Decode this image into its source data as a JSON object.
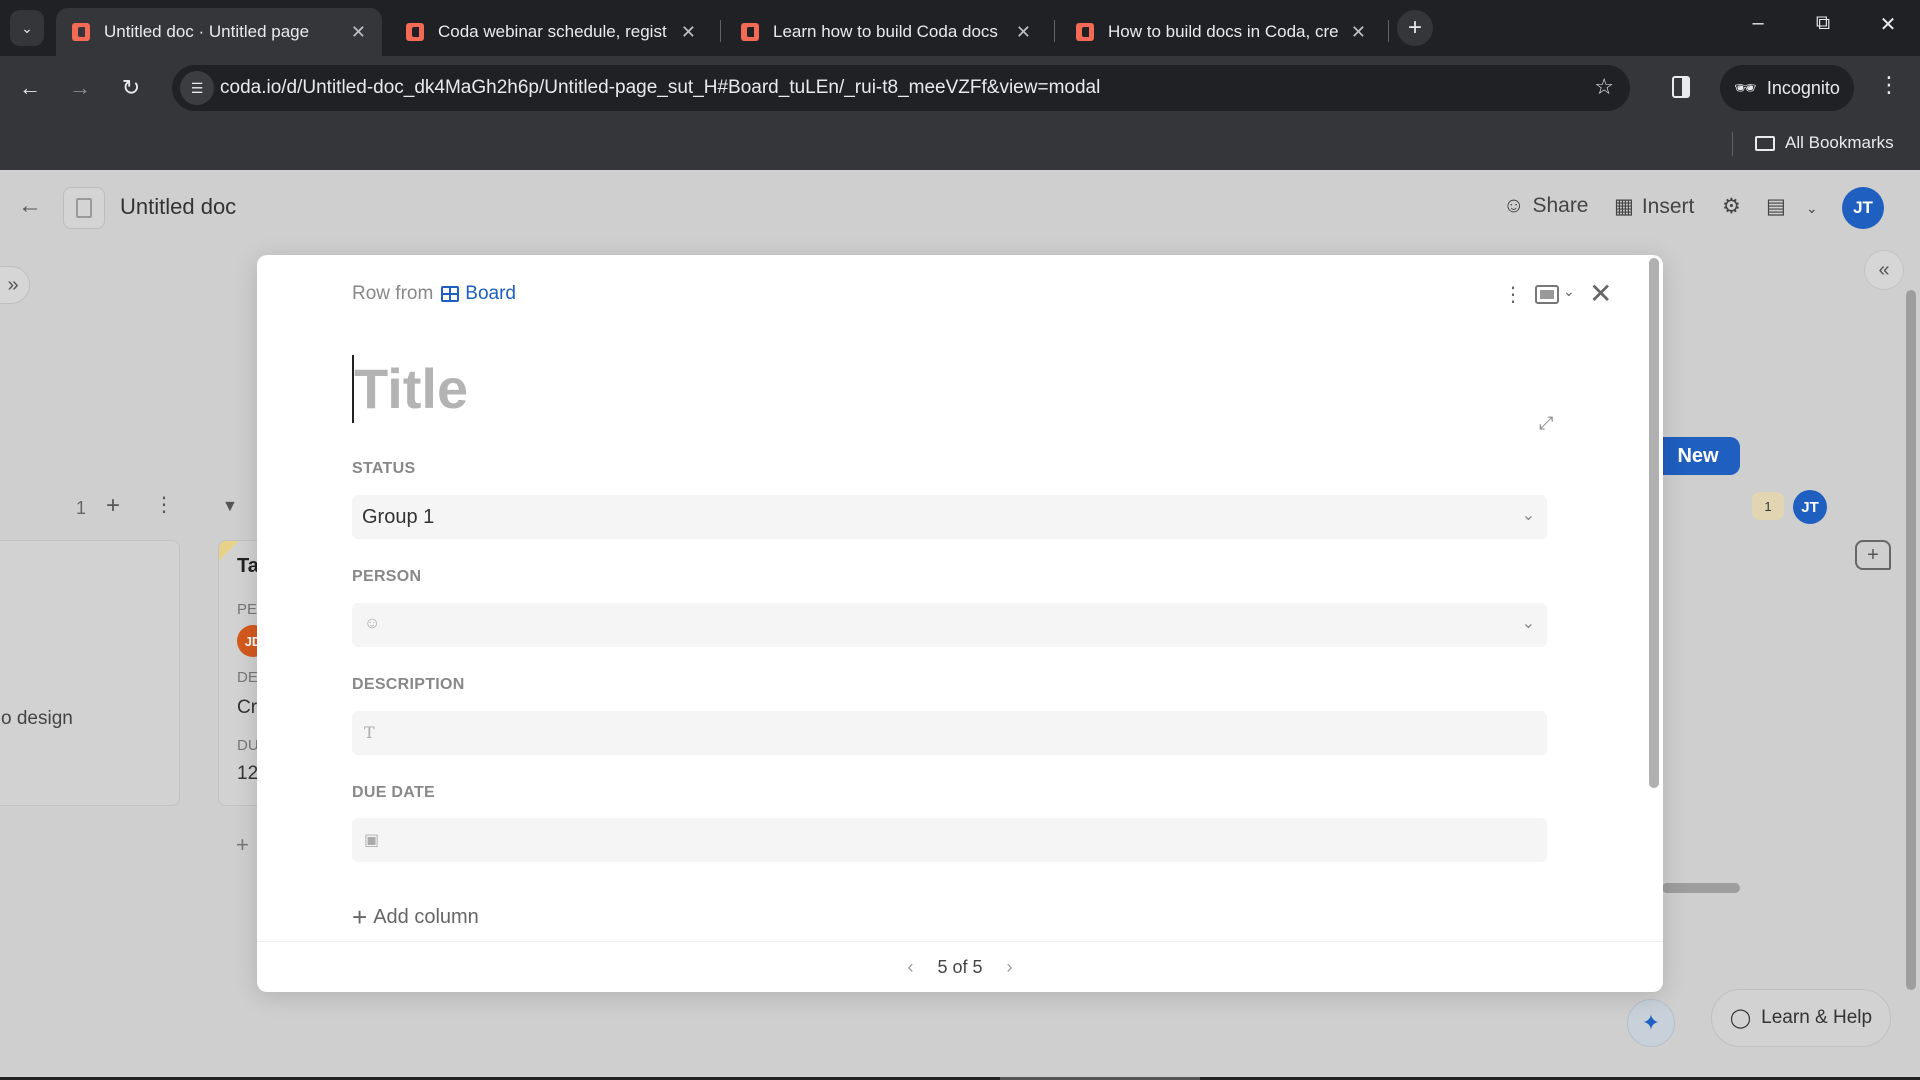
{
  "browser": {
    "tabs": [
      {
        "title": "Untitled doc · Untitled page",
        "active": true
      },
      {
        "title": "Coda webinar schedule, regist",
        "active": false
      },
      {
        "title": "Learn how to build Coda docs",
        "active": false
      },
      {
        "title": "How to build docs in Coda, cre",
        "active": false
      }
    ],
    "url": "coda.io/d/Untitled-doc_dk4MaGh2h6p/Untitled-page_sut_H#Board_tuLEn/_rui-t8_meeVZFf&view=modal",
    "incognito_label": "Incognito",
    "all_bookmarks_label": "All Bookmarks"
  },
  "coda_header": {
    "doc_title": "Untitled doc",
    "share_label": "Share",
    "insert_label": "Insert",
    "user_initials": "JT"
  },
  "board": {
    "group_count": "1",
    "card1_desc": "o design",
    "card2_title": "Ta",
    "card2_person_label": "PE",
    "card2_person_initials": "JD",
    "card2_desc_label": "DE",
    "card2_desc_value": "Cr",
    "card2_due_label": "DU",
    "card2_due_value": "12",
    "new_button_label": "New",
    "comment_count": "1",
    "board_avatar_initials": "JT"
  },
  "modal": {
    "row_from_label": "Row from",
    "source_table": "Board",
    "title_placeholder": "Title",
    "fields": [
      {
        "label": "STATUS",
        "value": "Group 1",
        "icon": "none",
        "has_dropdown": true
      },
      {
        "label": "PERSON",
        "value": "",
        "icon": "person-icon",
        "has_dropdown": true
      },
      {
        "label": "DESCRIPTION",
        "value": "",
        "icon": "text-icon",
        "has_dropdown": false
      },
      {
        "label": "DUE DATE",
        "value": "",
        "icon": "calendar-icon",
        "has_dropdown": false
      }
    ],
    "add_column_label": "Add column",
    "pagination": "5 of 5"
  },
  "help": {
    "learn_help_label": "Learn & Help"
  }
}
